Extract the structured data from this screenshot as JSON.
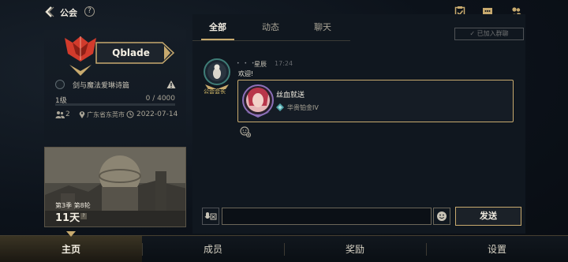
{
  "topbar": {
    "title": "公会",
    "help": "?",
    "icons": [
      "checklist-icon",
      "chat-bubble-icon",
      "friends-icon"
    ]
  },
  "profile": {
    "player_name": "Qblade",
    "guild_name": "剑与魔法爱琳诗篇",
    "level": "1级",
    "xp_text": "0 / 4000",
    "xp_fraction": 0,
    "members": "2",
    "location": "广东省东莞市",
    "date": "2022-07-14"
  },
  "season": {
    "label": "第3季 第8轮",
    "days": "11天",
    "info": "?"
  },
  "tabs": [
    {
      "label": "全部",
      "active": true
    },
    {
      "label": "动态",
      "active": false
    },
    {
      "label": "聊天",
      "active": false
    }
  ],
  "joined_button": "✓ 已加入群聊",
  "message": {
    "role_badge": "公会会长",
    "stars": "• • •",
    "sender": "星辰",
    "time": "17:24",
    "text": "欢迎!",
    "share": {
      "title": "丝血就送",
      "rank": "华贵铂金IV"
    }
  },
  "input": {
    "value": "",
    "send_label": "发送"
  },
  "bottom_nav": [
    {
      "label": "主页",
      "active": true
    },
    {
      "label": "成员",
      "active": false
    },
    {
      "label": "奖励",
      "active": false
    },
    {
      "label": "设置",
      "active": false
    }
  ],
  "colors": {
    "accent_gold": "#c8aa6e",
    "emblem_red": "#d23b2c",
    "background": "#0a1017"
  }
}
